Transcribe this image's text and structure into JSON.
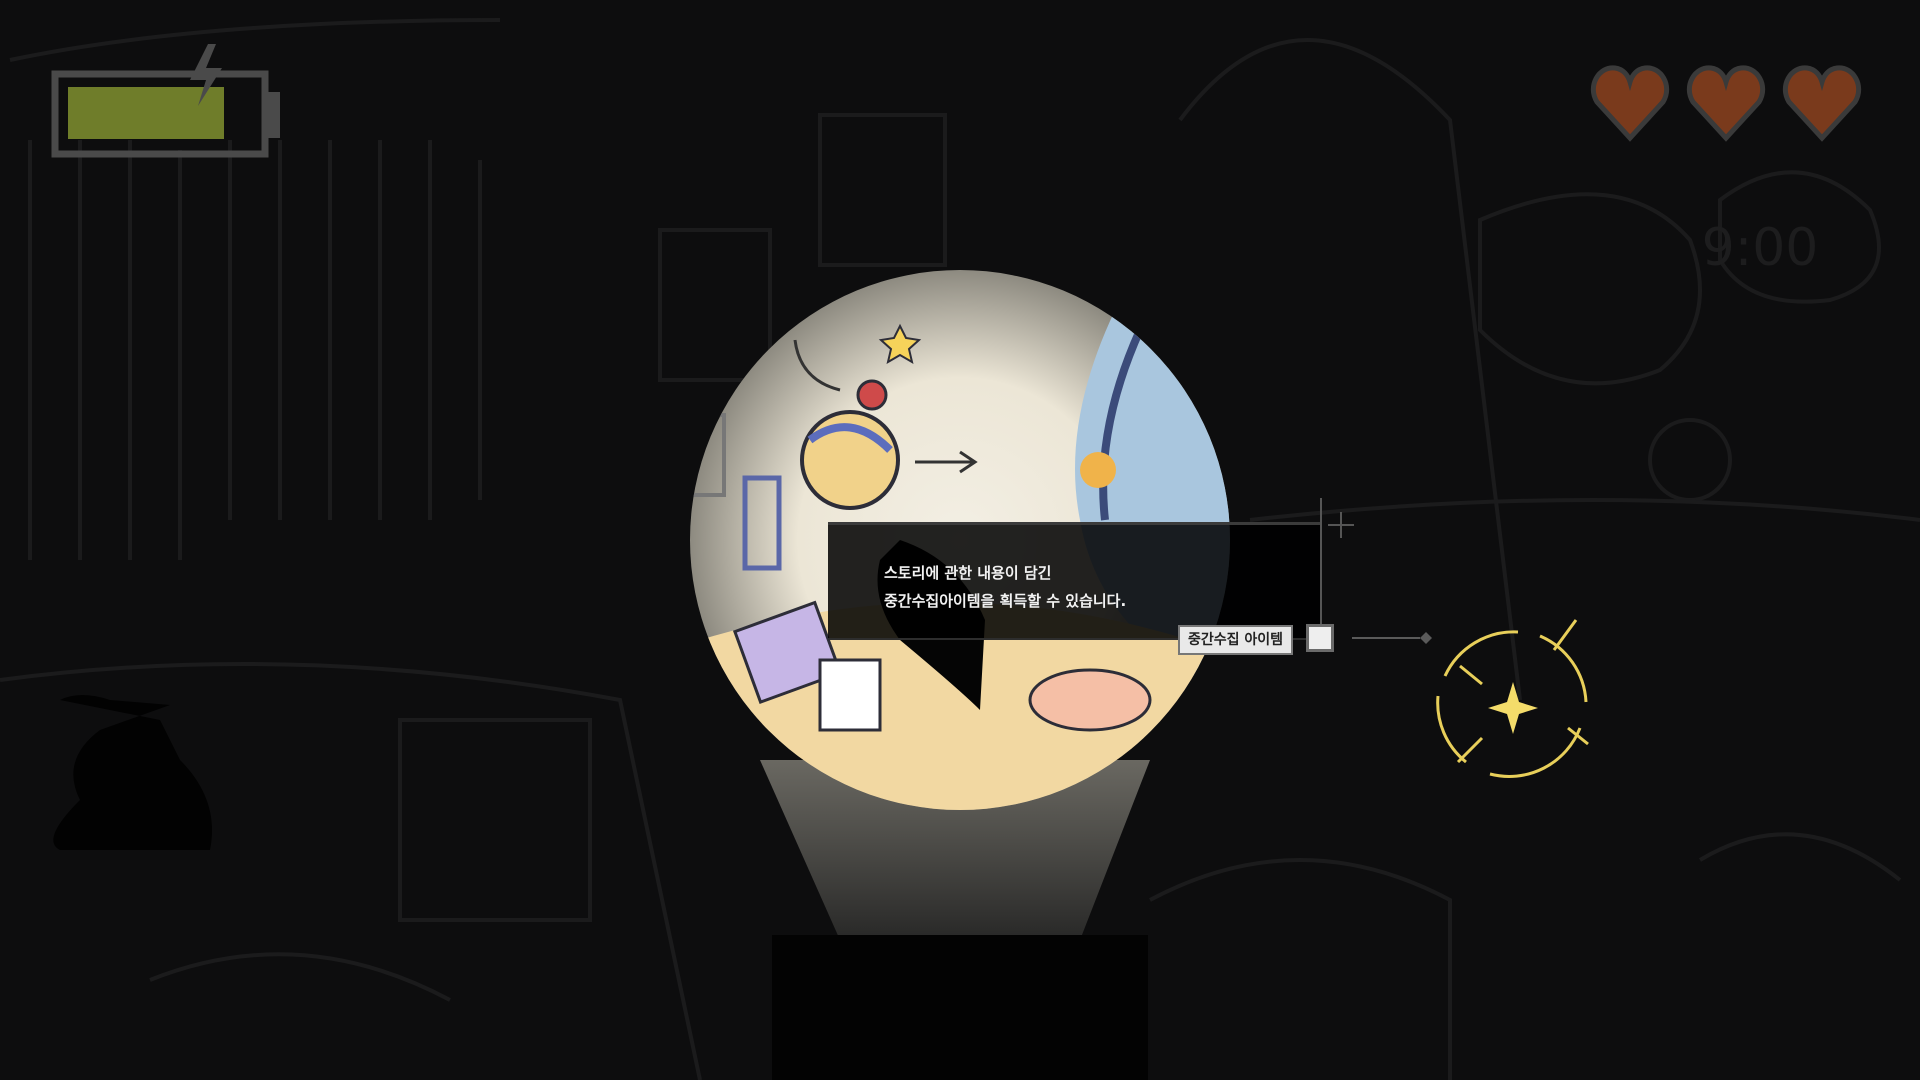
{
  "hud": {
    "battery": {
      "level": 0.85,
      "color": "#6f7d2a",
      "charging_icon": "lightning-icon"
    },
    "hearts": {
      "count": 3,
      "full": 3,
      "color": "#7a3a1c"
    }
  },
  "tooltip": {
    "line1": "스토리에 관한 내용이 담긴",
    "line2": "중간수집아이템을 획득할 수 있습니다.",
    "tag_label": "중간수집 아이템"
  },
  "interaction": {
    "icon": "sparkle-target-icon",
    "color": "#e8cf5a"
  }
}
